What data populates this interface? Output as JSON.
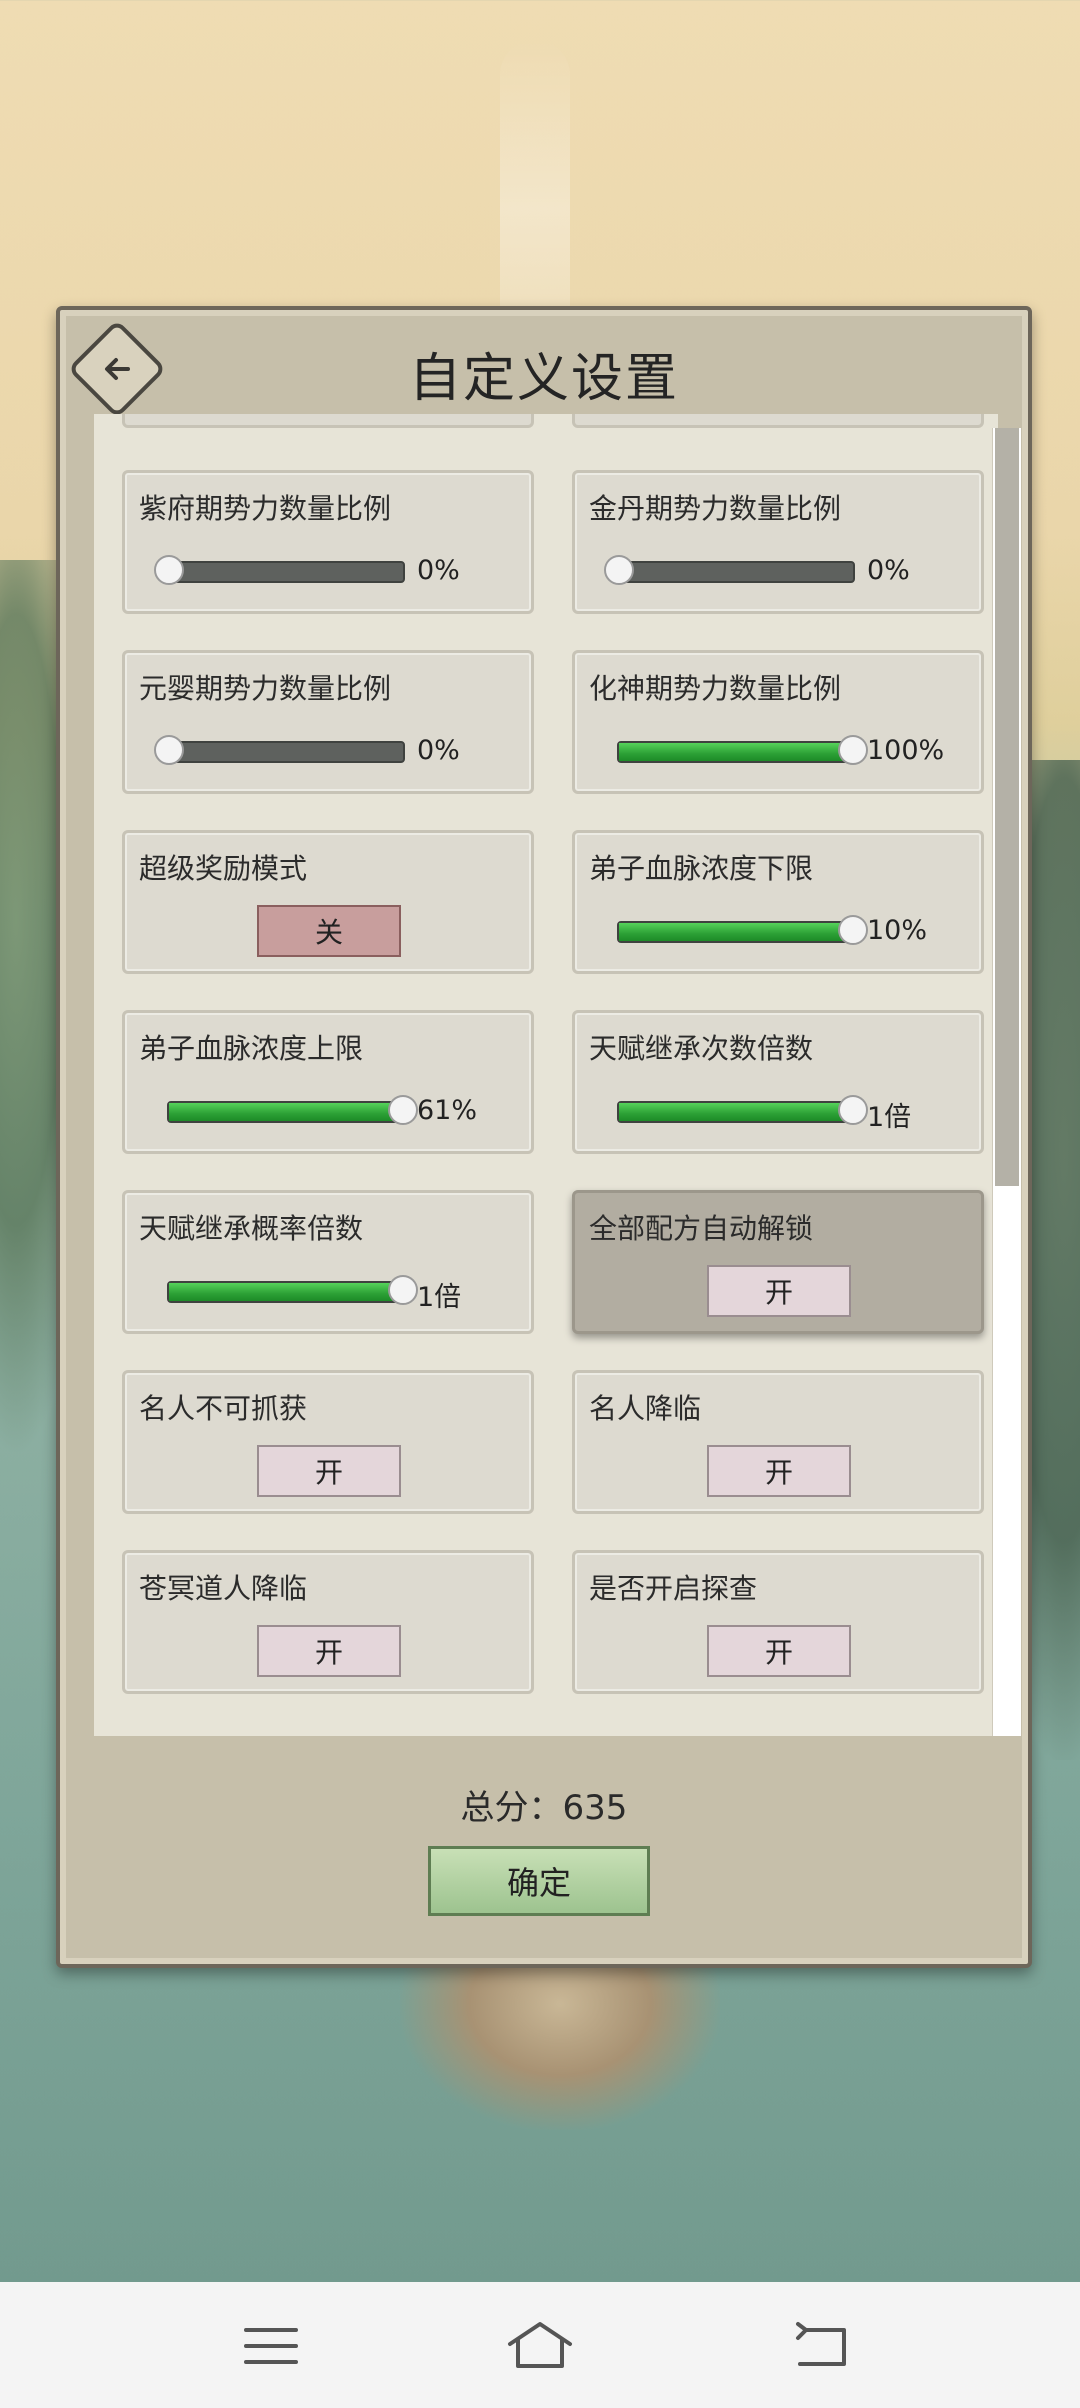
{
  "dialog": {
    "title": "自定义设置",
    "score_text": "总分：635",
    "confirm_label": "确定"
  },
  "settings": [
    {
      "label": "紫府期势力数量比例",
      "type": "slider",
      "value": 0,
      "display": "0%"
    },
    {
      "label": "金丹期势力数量比例",
      "type": "slider",
      "value": 0,
      "display": "0%"
    },
    {
      "label": "元婴期势力数量比例",
      "type": "slider",
      "value": 0,
      "display": "0%"
    },
    {
      "label": "化神期势力数量比例",
      "type": "slider",
      "value": 1,
      "display": "100%"
    },
    {
      "label": "超级奖励模式",
      "type": "toggle",
      "state": "off",
      "display": "关"
    },
    {
      "label": "弟子血脉浓度下限",
      "type": "slider",
      "value": 1,
      "display": "10%"
    },
    {
      "label": "弟子血脉浓度上限",
      "type": "slider",
      "value": 1,
      "display": "61%"
    },
    {
      "label": "天赋继承次数倍数",
      "type": "slider",
      "value": 1,
      "display": "1倍"
    },
    {
      "label": "天赋继承概率倍数",
      "type": "slider",
      "value": 1,
      "display": "1倍"
    },
    {
      "label": "全部配方自动解锁",
      "type": "toggle",
      "state": "on",
      "display": "开"
    },
    {
      "label": "名人不可抓获",
      "type": "toggle",
      "state": "on",
      "display": "开"
    },
    {
      "label": "名人降临",
      "type": "toggle",
      "state": "on",
      "display": "开"
    },
    {
      "label": "苍冥道人降临",
      "type": "toggle",
      "state": "on",
      "display": "开"
    },
    {
      "label": "是否开启探查",
      "type": "toggle",
      "state": "on",
      "display": "开"
    }
  ],
  "colors": {
    "slider_fill": "#2ca035",
    "slider_track": "#5e615e",
    "toggle_off": "#c89e9d",
    "toggle_on": "#e4d6da"
  },
  "icons": {
    "back": "back-arrow-icon",
    "nav_menu": "menu-icon",
    "nav_home": "home-icon",
    "nav_back": "back-icon"
  }
}
